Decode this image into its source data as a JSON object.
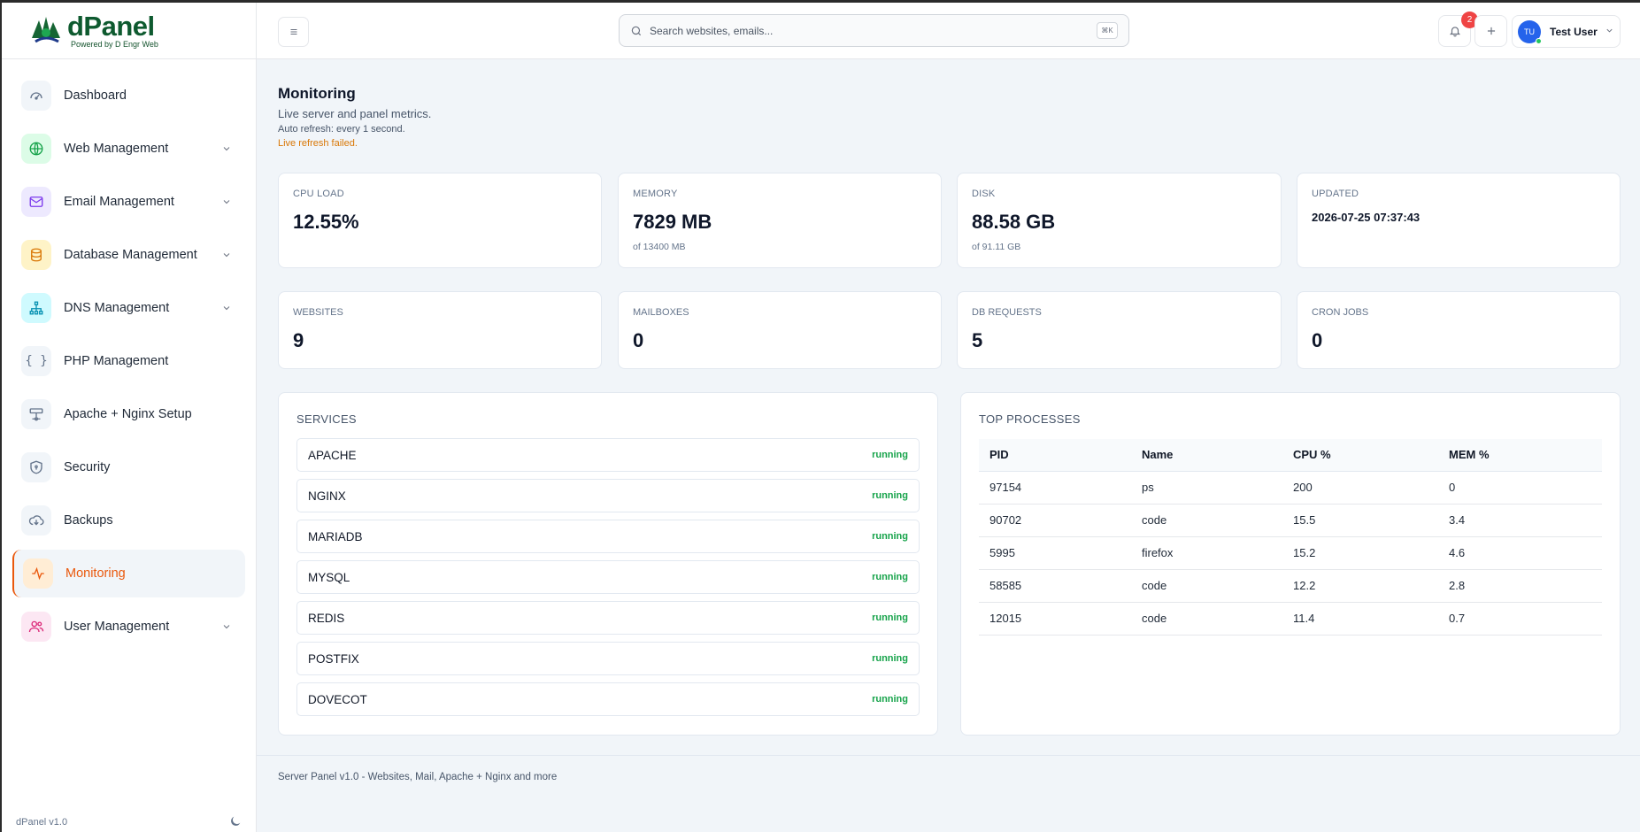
{
  "brand": {
    "name": "dPanel",
    "tagline": "Powered by D Engr Web"
  },
  "sidebar": {
    "items": [
      {
        "label": "Dashboard",
        "icon": "gauge-icon"
      },
      {
        "label": "Web Management",
        "icon": "globe-icon"
      },
      {
        "label": "Email Management",
        "icon": "mail-icon"
      },
      {
        "label": "Database Management",
        "icon": "database-icon"
      },
      {
        "label": "DNS Management",
        "icon": "network-icon"
      },
      {
        "label": "PHP Management",
        "icon": "braces-icon"
      },
      {
        "label": "Apache + Nginx Setup",
        "icon": "server-icon"
      },
      {
        "label": "Security",
        "icon": "shield-icon"
      },
      {
        "label": "Backups",
        "icon": "cloud-download-icon"
      },
      {
        "label": "Monitoring",
        "icon": "activity-icon"
      },
      {
        "label": "User Management",
        "icon": "users-icon"
      }
    ],
    "version": "dPanel v1.0"
  },
  "header": {
    "search_placeholder": "Search websites, emails...",
    "shortcut": "⌘K",
    "notification_count": "2",
    "user_initials": "TU",
    "user_name": "Test User"
  },
  "page": {
    "title": "Monitoring",
    "subtitle": "Live server and panel metrics.",
    "auto_refresh": "Auto refresh: every 1 second.",
    "error": "Live refresh failed."
  },
  "stats": {
    "cpu": {
      "label": "CPU LOAD",
      "value": "12.55%"
    },
    "memory": {
      "label": "MEMORY",
      "value": "7829 MB",
      "sub": "of 13400 MB"
    },
    "disk": {
      "label": "DISK",
      "value": "88.58 GB",
      "sub": "of 91.11 GB"
    },
    "updated": {
      "label": "UPDATED",
      "value": "2026-07-25 07:37:43"
    },
    "websites": {
      "label": "WEBSITES",
      "value": "9"
    },
    "mailboxes": {
      "label": "MAILBOXES",
      "value": "0"
    },
    "db_requests": {
      "label": "DB REQUESTS",
      "value": "5"
    },
    "cron_jobs": {
      "label": "CRON JOBS",
      "value": "0"
    }
  },
  "services": {
    "title": "SERVICES",
    "items": [
      {
        "name": "APACHE",
        "status": "running"
      },
      {
        "name": "NGINX",
        "status": "running"
      },
      {
        "name": "MARIADB",
        "status": "running"
      },
      {
        "name": "MYSQL",
        "status": "running"
      },
      {
        "name": "REDIS",
        "status": "running"
      },
      {
        "name": "POSTFIX",
        "status": "running"
      },
      {
        "name": "DOVECOT",
        "status": "running"
      }
    ]
  },
  "processes": {
    "title": "TOP PROCESSES",
    "columns": [
      "PID",
      "Name",
      "CPU %",
      "MEM %"
    ],
    "rows": [
      [
        "97154",
        "ps",
        "200",
        "0"
      ],
      [
        "90702",
        "code",
        "15.5",
        "3.4"
      ],
      [
        "5995",
        "firefox",
        "15.2",
        "4.6"
      ],
      [
        "58585",
        "code",
        "12.2",
        "2.8"
      ],
      [
        "12015",
        "code",
        "11.4",
        "0.7"
      ]
    ]
  },
  "footer": {
    "text": "Server Panel v1.0 - Websites, Mail, Apache + Nginx and more"
  },
  "colors": {
    "accent": "#ea580c",
    "success": "#16a34a",
    "warning": "#d97706",
    "brand": "#0e5a2f"
  }
}
